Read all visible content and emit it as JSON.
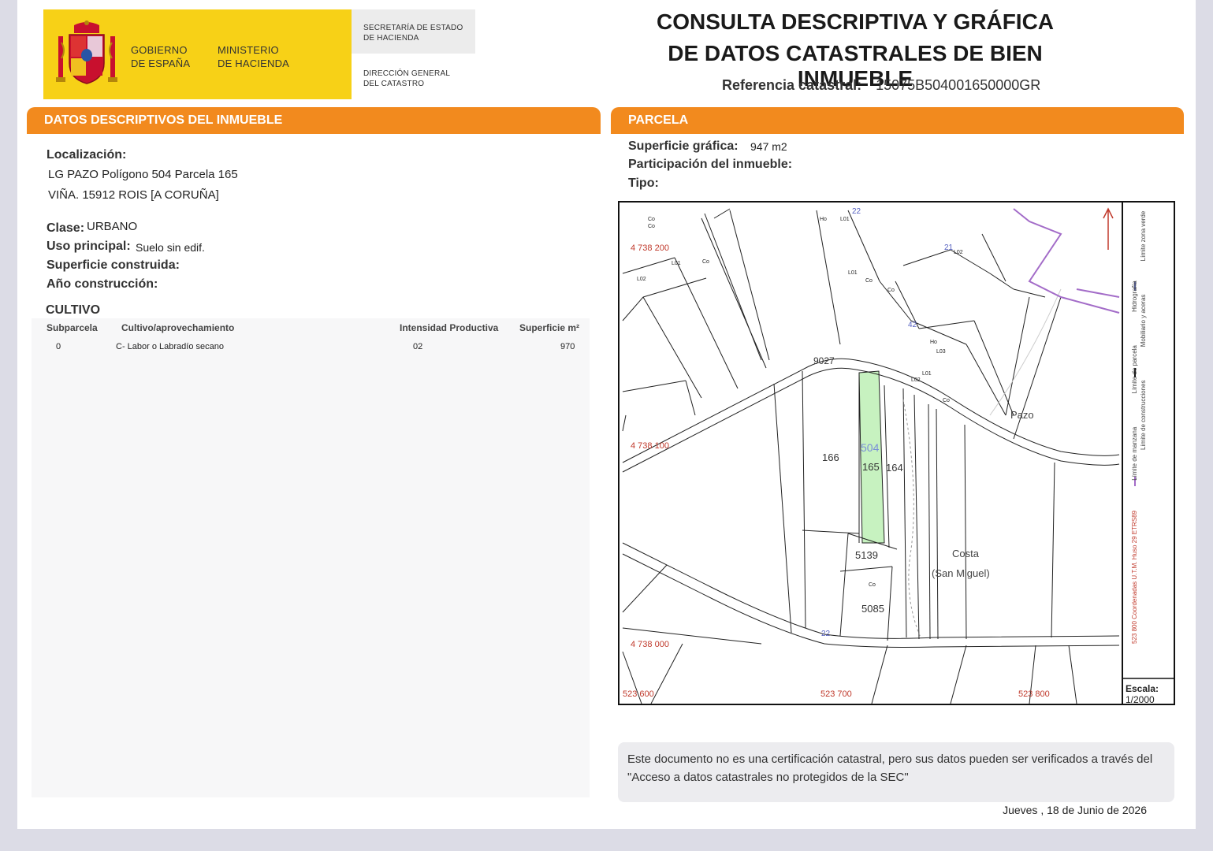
{
  "header": {
    "gobierno": [
      "GOBIERNO",
      "DE ESPAÑA"
    ],
    "ministerio": [
      "MINISTERIO",
      "DE HACIENDA"
    ],
    "secretaria": [
      "SECRETARÍA DE ESTADO",
      "DE HACIENDA"
    ],
    "direccion": [
      "DIRECCIÓN GENERAL",
      "DEL CATASTRO"
    ],
    "title_line1": "CONSULTA DESCRIPTIVA Y GRÁFICA",
    "title_line2": "DE DATOS CATASTRALES DE BIEN INMUEBLE",
    "ref_label": "Referencia catastral:",
    "ref_value": "15075B504001650000GR"
  },
  "descriptivos": {
    "heading": "DATOS DESCRIPTIVOS DEL INMUEBLE",
    "localizacion_label": "Localización:",
    "localizacion_line1": "LG PAZO  Polígono 504 Parcela 165",
    "localizacion_line2": "VIÑA. 15912 ROIS [A CORUÑA]",
    "clase_label": "Clase:",
    "clase_value": "URBANO",
    "uso_label": "Uso principal:",
    "uso_value": "Suelo sin edif.",
    "superficie_label": "Superficie construida:",
    "ano_label": "Año construcción:",
    "cultivo_heading": "CULTIVO",
    "table_headers": [
      "Subparcela",
      "Cultivo/aprovechamiento",
      "Intensidad Productiva",
      "Superficie m²"
    ],
    "table_rows": [
      [
        "0",
        "C- Labor o Labradío secano",
        "02",
        "970"
      ]
    ]
  },
  "parcela": {
    "heading": "PARCELA",
    "superficie_label": "Superficie gráfica:",
    "superficie_value": "947 m2",
    "participacion_label": "Participación del inmueble:",
    "tipo_label": "Tipo:"
  },
  "map": {
    "coord_y_top": "4 738 200",
    "coord_y_mid": "4 738 100",
    "coord_y_low": "4 738 000",
    "coord_x_left": "523 600",
    "coord_x_mid": "523 700",
    "coord_x_right": "523 800",
    "parcel_labels": [
      "9027",
      "166",
      "504",
      "165",
      "164",
      "5139",
      "5085",
      "22",
      "21",
      "42",
      "22"
    ],
    "place_pazo": "Pazo",
    "place_costa": "Costa",
    "place_san_miguel": "(San Miguel)",
    "small_codes": [
      "Co",
      "Co",
      "Ho",
      "L01",
      "L02",
      "L01",
      "Co",
      "L01",
      "Co",
      "Co",
      "Ho",
      "L03",
      "L01",
      "L02",
      "Co",
      "Co",
      "L02"
    ],
    "legend_lines": [
      "Límite de manzana",
      "Límite de parcela",
      "Límite de construcciones",
      "Mobiliario y aceras",
      "Límite zona verde",
      "Hidrografía"
    ],
    "legend_coords": "523 800 Coordenadas U.T.M. Huso 29 ETRS89",
    "scale_label": "Escala:",
    "scale_value": "1/2000",
    "colors": {
      "selected_parcel": "#c7f2c0",
      "hydro": "#a36cc8",
      "coords": "#c0392b"
    }
  },
  "footer": {
    "notice": "Este documento no es una certificación catastral, pero sus datos pueden ser verificados a través del \"Acceso a datos catastrales no protegidos de la SEC\"",
    "date": "Jueves , 18 de Junio de 2026"
  }
}
